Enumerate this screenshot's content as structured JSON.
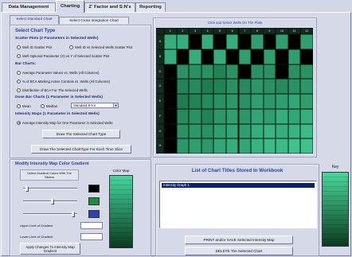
{
  "tabs": [
    {
      "label": "Data Management",
      "selected": false
    },
    {
      "label": "Charting",
      "selected": true
    },
    {
      "label": "Z' Factor and S:N's",
      "selected": false
    },
    {
      "label": "Reporting",
      "selected": false
    }
  ],
  "subtabs": [
    {
      "label": "Select Standard Chart",
      "selected": true
    },
    {
      "label": "Select Cross Integration Chart",
      "selected": false
    }
  ],
  "chart_type": {
    "title": "Select Chart Type",
    "scatter": {
      "heading": "Scatter Plots (2 Parameters in Selected Wells)",
      "options": [
        {
          "label": "Well ID Scatter Plot",
          "selected": false
        },
        {
          "label": "Well ID vs Selected Wells Scatter Plot",
          "selected": false
        },
        {
          "label": "Well Optional Parameter (X) vs Y of Selected Scatter Plot",
          "selected": false
        }
      ]
    },
    "bar": {
      "heading": "Bar Charts:",
      "options": [
        {
          "label": "Average Parameter Values vs. Wells (All Columns)",
          "selected": false
        },
        {
          "label": "% of BCA Marking Active Controls vs. Wells (All Columns)",
          "selected": false
        },
        {
          "label": "Distribution of BCA For The Selected Wells",
          "selected": false
        }
      ]
    },
    "dose": {
      "heading": "Dose Bar Charts (1 Parameter in Selected Wells)",
      "options": [
        {
          "label": "Mean",
          "selected": false
        },
        {
          "label": "Median",
          "selected": false
        }
      ],
      "error_type": "Standard Error"
    },
    "intensity": {
      "heading": "Intensity Maps (1 Parameter in Selected Wells)",
      "options": [
        {
          "label": "Average Intensity Map for One Parameter in Selected Wells",
          "selected": true
        }
      ]
    },
    "draw_button": "Draw The Selected Chart Type",
    "draw_each_button": "Draw The Selected ChartType For Each Time Slice"
  },
  "plate": {
    "caption": "Click and Select Wells On The Plate",
    "columns": [
      "1",
      "2",
      "3",
      "4",
      "5",
      "6",
      "7",
      "8",
      "9",
      "10",
      "11",
      "12"
    ],
    "rows": [
      "A",
      "B",
      "C",
      "D",
      "E",
      "F",
      "G",
      "H"
    ],
    "levels": [
      [
        0.7,
        0.7,
        null,
        0.7,
        null,
        0.7,
        null,
        0.6,
        null,
        0.6,
        null,
        0.6
      ],
      [
        0.7,
        null,
        0.7,
        null,
        0.7,
        null,
        0.6,
        null,
        0.6,
        null,
        0.6,
        null
      ],
      [
        null,
        0.5,
        0.5,
        0.5,
        0.4,
        0.5,
        null,
        0.5,
        0.5,
        null,
        0.5,
        0.5
      ],
      [
        null,
        0.4,
        0.45,
        0.35,
        0.4,
        0.5,
        0.45,
        0.55,
        0.5,
        0.45,
        0.5,
        0.55
      ],
      [
        null,
        0.35,
        0.4,
        0.45,
        0.5,
        0.55,
        0.5,
        0.6,
        0.55,
        0.6,
        0.65,
        0.6
      ],
      [
        null,
        0.45,
        0.5,
        0.4,
        0.55,
        0.6,
        0.55,
        0.65,
        0.6,
        0.7,
        0.65,
        0.7
      ],
      [
        null,
        0.5,
        0.55,
        0.5,
        0.6,
        0.65,
        0.6,
        0.7,
        0.75,
        0.7,
        0.75,
        0.8
      ],
      [
        null,
        0.55,
        0.6,
        0.55,
        0.65,
        0.7,
        0.65,
        0.75,
        0.8,
        0.8,
        0.85,
        0.85
      ]
    ],
    "colors": {
      "empty": "#000000",
      "low": "#0b4a27",
      "high": "#4ad6a0"
    }
  },
  "gradient_panel": {
    "title": "Modify Intensity Map Color Gradient",
    "instructions": "Select Gradient Colors With The Sliders",
    "color_map_label": "Color Map",
    "slider_levels": [
      0.05,
      0.55,
      0.95
    ],
    "swatch_colors": [
      "#000000",
      "#1d8a43",
      "#2b43b0"
    ],
    "upper_label": "Upper Limit of Gradient",
    "lower_label": "Lower Limit of Gradient",
    "apply_button": "Apply Changes To Intensity Map Gradient",
    "gradient_colors": [
      "#45d69e",
      "#0a3d20"
    ]
  },
  "chart_list": {
    "title": "List of Chart Titles Stored In Workbook",
    "items": [
      {
        "label": "Intensity Graph 1",
        "selected": true
      }
    ],
    "print_button": "PRINT and/or SAVE Selected Intensity Map",
    "delete_button": "DELETE The Selected Chart"
  },
  "key": {
    "label": "Key",
    "gradient_colors": [
      "#49d89a",
      "#0b3c1f"
    ]
  },
  "colors": {
    "accent_text": "#2646a8",
    "selection": "#0a246a"
  }
}
